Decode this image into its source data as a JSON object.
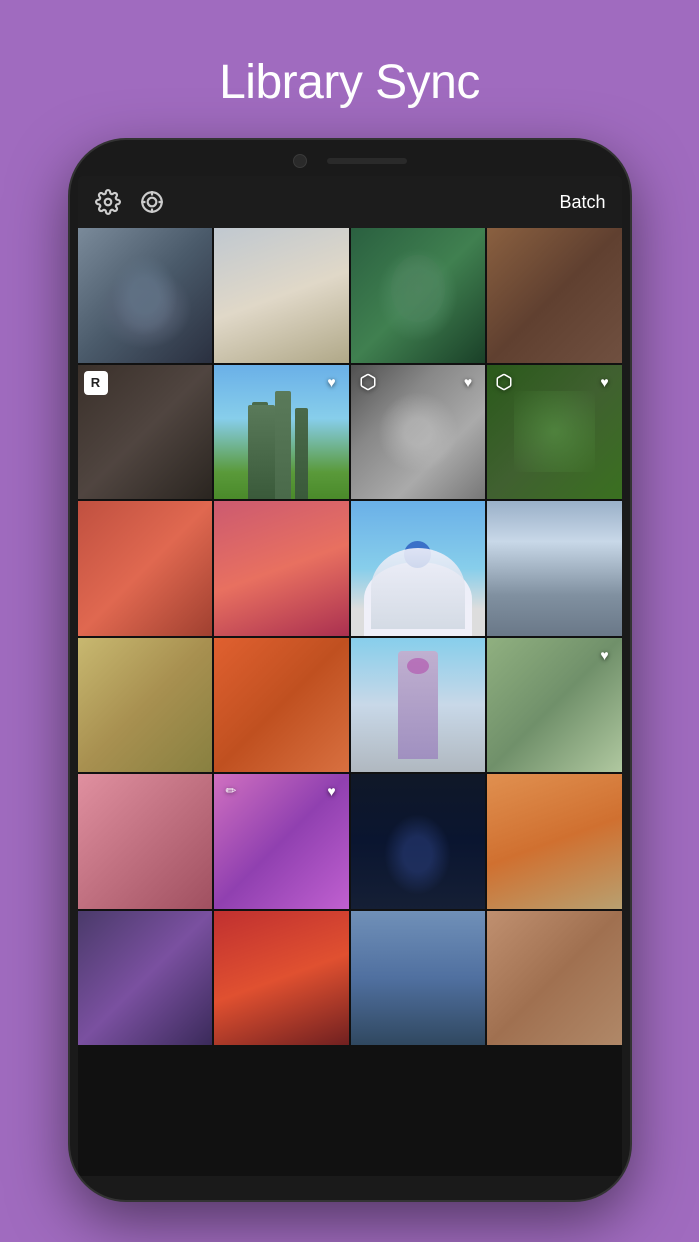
{
  "page": {
    "title": "Library Sync",
    "background_color": "#a06bbf"
  },
  "toolbar": {
    "batch_label": "Batch",
    "gear_icon": "gear-icon",
    "lens_icon": "lens-icon"
  },
  "photos": [
    {
      "id": 1,
      "class": "p1",
      "badge_type": "none"
    },
    {
      "id": 2,
      "class": "p2",
      "badge_type": "none"
    },
    {
      "id": 3,
      "class": "p3",
      "badge_type": "none",
      "selected": true
    },
    {
      "id": 4,
      "class": "p4",
      "badge_type": "none"
    },
    {
      "id": 5,
      "class": "p5",
      "badge_type": "letter",
      "letter": "R"
    },
    {
      "id": 6,
      "class": "p6",
      "badge_type": "heart"
    },
    {
      "id": 7,
      "class": "p7",
      "badge_type": "cube_heart"
    },
    {
      "id": 8,
      "class": "p8",
      "badge_type": "cube_heart"
    },
    {
      "id": 9,
      "class": "p9",
      "badge_type": "none"
    },
    {
      "id": 10,
      "class": "p10",
      "badge_type": "none"
    },
    {
      "id": 11,
      "class": "p11",
      "badge_type": "none"
    },
    {
      "id": 12,
      "class": "p12",
      "badge_type": "none"
    },
    {
      "id": 13,
      "class": "p13",
      "badge_type": "none"
    },
    {
      "id": 14,
      "class": "p14",
      "badge_type": "none"
    },
    {
      "id": 15,
      "class": "p15",
      "badge_type": "none"
    },
    {
      "id": 16,
      "class": "p16",
      "badge_type": "heart"
    },
    {
      "id": 17,
      "class": "p17",
      "badge_type": "none"
    },
    {
      "id": 18,
      "class": "p18",
      "badge_type": "edit_heart"
    },
    {
      "id": 19,
      "class": "p19",
      "badge_type": "none"
    },
    {
      "id": 20,
      "class": "p20",
      "badge_type": "none"
    },
    {
      "id": 21,
      "class": "p21",
      "badge_type": "none"
    },
    {
      "id": 22,
      "class": "p22",
      "badge_type": "none"
    },
    {
      "id": 23,
      "class": "p23",
      "badge_type": "none"
    },
    {
      "id": 24,
      "class": "p24",
      "badge_type": "none"
    }
  ]
}
